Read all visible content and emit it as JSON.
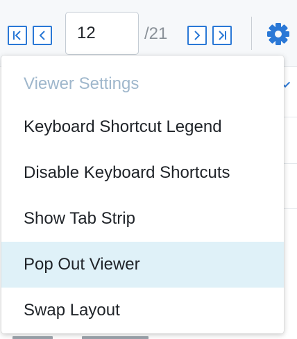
{
  "toolbar": {
    "first_page_icon": "first-page-icon",
    "prev_page_icon": "prev-page-icon",
    "page_input_value": "12",
    "page_total": "/21",
    "next_page_icon": "next-page-icon",
    "last_page_icon": "last-page-icon",
    "settings_icon": "gear-icon",
    "accent_color": "#2a78d6"
  },
  "menu": {
    "header": "Viewer Settings",
    "items": [
      {
        "label": "Keyboard Shortcut Legend"
      },
      {
        "label": "Disable Keyboard Shortcuts"
      },
      {
        "label": "Show Tab Strip"
      },
      {
        "label": "Pop Out Viewer",
        "highlighted": true
      },
      {
        "label": "Swap Layout"
      }
    ],
    "highlight_color": "#dff1f8"
  }
}
